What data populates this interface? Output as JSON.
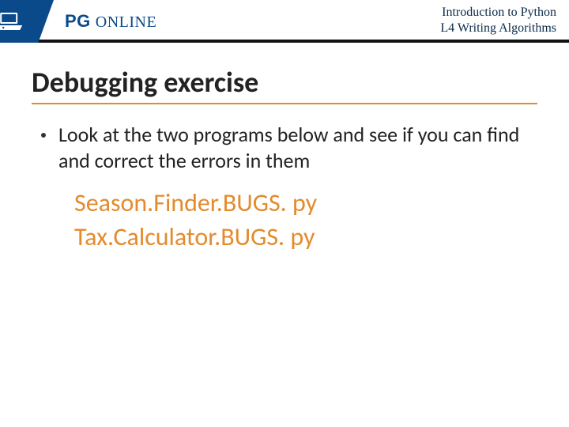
{
  "header": {
    "brand_bold": "PG",
    "brand_light": "ONLINE",
    "course_line1": "Introduction to Python",
    "course_line2": "L4 Writing Algorithms"
  },
  "slide": {
    "title": "Debugging exercise",
    "bullet": "Look at the two programs below and see if you can find and correct the errors in them",
    "files": [
      "Season.Finder.BUGS. py",
      "Tax.Calculator.BUGS. py"
    ]
  },
  "colors": {
    "accent_orange": "#e38b2d",
    "brand_blue": "#0a4a8a"
  }
}
